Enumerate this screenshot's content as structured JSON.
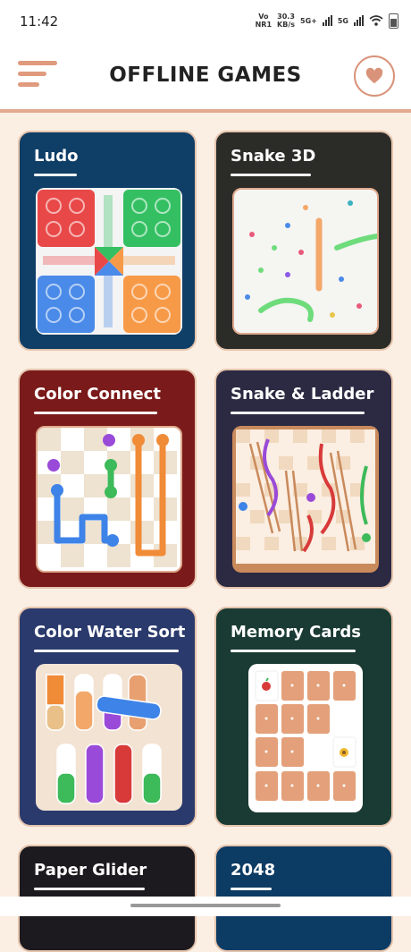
{
  "status": {
    "time": "11:42",
    "carrier": "Vo\nNR1",
    "speed": "30.3\nKB/s",
    "net1": "5G+",
    "net2": "5G"
  },
  "header": {
    "title": "OFFLINE GAMES",
    "menu_icon": "hamburger-menu-icon",
    "favorite_icon": "heart-icon"
  },
  "games": [
    {
      "name": "Ludo",
      "bg": "#0f3e67"
    },
    {
      "name": "Snake 3D",
      "bg": "#2b2b28"
    },
    {
      "name": "Color Connect",
      "bg": "#7a1a1a"
    },
    {
      "name": "Snake & Ladder",
      "bg": "#2c2a42"
    },
    {
      "name": "Color Water Sort",
      "bg": "#2a3a6c"
    },
    {
      "name": "Memory Cards",
      "bg": "#1a3b33"
    },
    {
      "name": "Paper Glider",
      "bg": "#1c1a1e"
    },
    {
      "name": "2048",
      "bg": "#0c3b64"
    }
  ],
  "colors": {
    "accent": "#e09a7e",
    "page_bg": "#fbeee2"
  }
}
